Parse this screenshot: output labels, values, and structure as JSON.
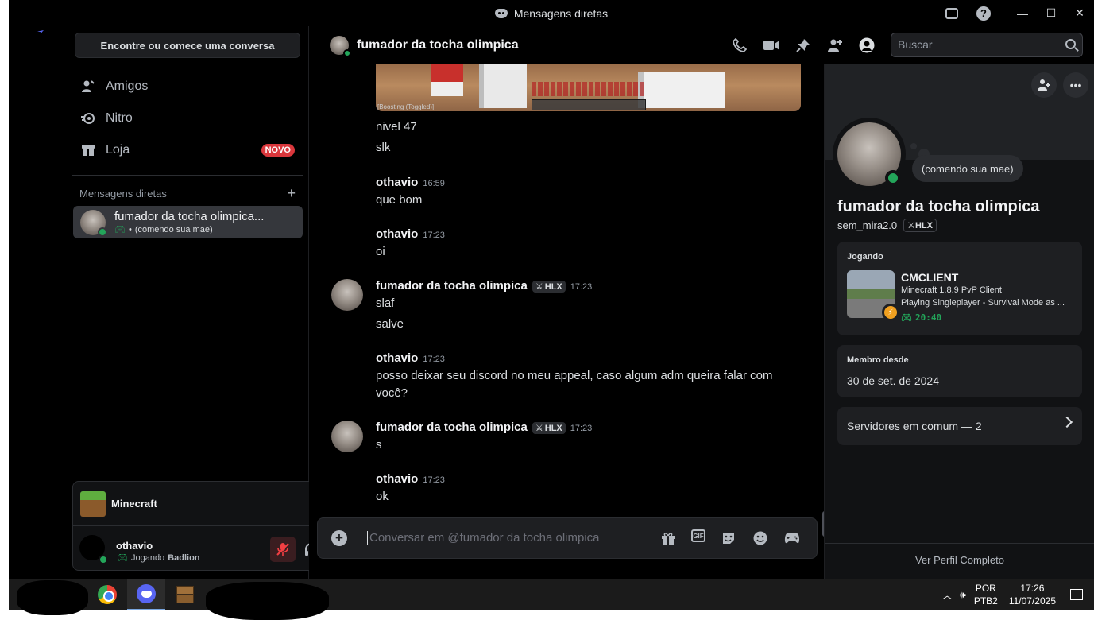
{
  "window": {
    "title": "Mensagens diretas",
    "controls": {
      "minimize": "—",
      "maximize": "☐",
      "close": "✕"
    }
  },
  "sidebar": {
    "find_button": "Encontre ou comece uma conversa",
    "nav": [
      {
        "label": "Amigos",
        "icon": "friends-icon"
      },
      {
        "label": "Nitro",
        "icon": "nitro-icon"
      },
      {
        "label": "Loja",
        "icon": "shop-icon",
        "badge": "NOVO"
      }
    ],
    "dm_header": "Mensagens diretas",
    "dm_add": "+",
    "dms": [
      {
        "name": "fumador da tocha olimpica...",
        "status": "(comendo sua mae)"
      }
    ],
    "activity": {
      "game": "Minecraft"
    },
    "user": {
      "name": "othavio",
      "status_prefix": "Jogando",
      "status_game": "Badlion"
    }
  },
  "chat": {
    "recipient": "fumador da tocha olimpica",
    "search_placeholder": "Buscar",
    "embed_caption": "[Boosting (Toggled)]",
    "messages": [
      {
        "author": "",
        "time": "",
        "lines": [
          "nivel 47",
          "slk"
        ]
      },
      {
        "author": "othavio",
        "time": "16:59",
        "lines": [
          "que bom"
        ]
      },
      {
        "author": "othavio",
        "time": "17:23",
        "lines": [
          "oi"
        ]
      },
      {
        "author": "fumador da tocha olimpica",
        "tag": "HLX",
        "time": "17:23",
        "lines": [
          "slaf",
          "salve"
        ]
      },
      {
        "author": "othavio",
        "time": "17:23",
        "lines": [
          "posso deixar seu discord no meu appeal, caso algum adm queira falar com",
          "você?"
        ]
      },
      {
        "author": "fumador da tocha olimpica",
        "tag": "HLX",
        "time": "17:23",
        "lines": [
          "s"
        ]
      },
      {
        "author": "othavio",
        "time": "17:23",
        "lines": [
          "ok"
        ]
      }
    ],
    "composer_placeholder": "Conversar em @fumador da tocha olimpica",
    "gif_label": "GIF"
  },
  "profile": {
    "status_text": "(comendo sua mae)",
    "display_name": "fumador da tocha olimpica",
    "username": "sem_mira2.0",
    "tag": "HLX",
    "activity": {
      "title": "Jogando",
      "name": "CMCLIENT",
      "details": "Minecraft 1.8.9 PvP Client",
      "state": "Playing Singleplayer - Survival Mode as ...",
      "elapsed": "20:40"
    },
    "member_since_title": "Membro desde",
    "member_since": "30 de set. de 2024",
    "mutual_servers": "Servidores em comum — 2",
    "footer": "Ver Perfil Completo"
  },
  "taskbar": {
    "lang": "POR",
    "layout": "PTB2",
    "time": "17:26",
    "date": "11/07/2025"
  },
  "colors": {
    "online": "#23a55a",
    "badge_red": "#da373c",
    "discord_blurple": "#5865f2"
  }
}
